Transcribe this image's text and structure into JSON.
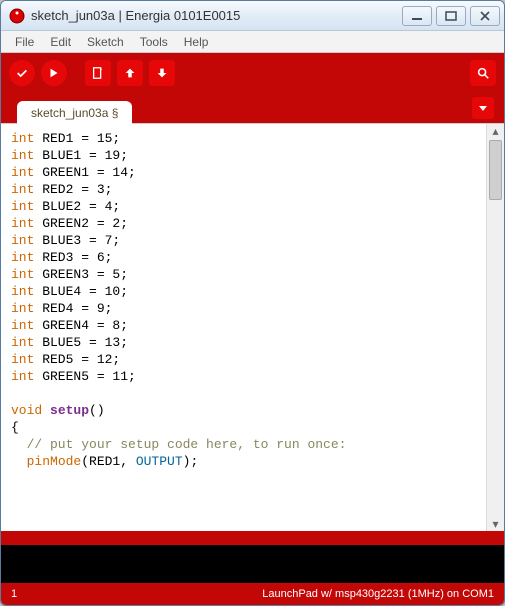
{
  "window": {
    "title": "sketch_jun03a | Energia 0101E0015"
  },
  "menu": {
    "file": "File",
    "edit": "Edit",
    "sketch": "Sketch",
    "tools": "Tools",
    "help": "Help"
  },
  "tabs": {
    "active": "sketch_jun03a §"
  },
  "code": {
    "lines": [
      {
        "t": "decl",
        "kw": "int",
        "name": "RED1",
        "val": "15"
      },
      {
        "t": "decl",
        "kw": "int",
        "name": "BLUE1",
        "val": "19"
      },
      {
        "t": "decl",
        "kw": "int",
        "name": "GREEN1",
        "val": "14"
      },
      {
        "t": "decl",
        "kw": "int",
        "name": "RED2",
        "val": "3"
      },
      {
        "t": "decl",
        "kw": "int",
        "name": "BLUE2",
        "val": "4"
      },
      {
        "t": "decl",
        "kw": "int",
        "name": "GREEN2",
        "val": "2"
      },
      {
        "t": "decl",
        "kw": "int",
        "name": "BLUE3",
        "val": "7"
      },
      {
        "t": "decl",
        "kw": "int",
        "name": "RED3",
        "val": "6"
      },
      {
        "t": "decl",
        "kw": "int",
        "name": "GREEN3",
        "val": "5"
      },
      {
        "t": "decl",
        "kw": "int",
        "name": "BLUE4",
        "val": "10"
      },
      {
        "t": "decl",
        "kw": "int",
        "name": "RED4",
        "val": "9"
      },
      {
        "t": "decl",
        "kw": "int",
        "name": "GREEN4",
        "val": "8"
      },
      {
        "t": "decl",
        "kw": "int",
        "name": "BLUE5",
        "val": "13"
      },
      {
        "t": "decl",
        "kw": "int",
        "name": "RED5",
        "val": "12"
      },
      {
        "t": "decl",
        "kw": "int",
        "name": "GREEN5",
        "val": "11"
      },
      {
        "t": "blank"
      },
      {
        "t": "funcsig",
        "kw": "void",
        "name": "setup",
        "args": "()"
      },
      {
        "t": "brace",
        "ch": "{"
      },
      {
        "t": "comment",
        "text": "  // put your setup code here, to run once:"
      },
      {
        "t": "call",
        "indent": "  ",
        "fn": "pinMode",
        "arg1": "RED1",
        "arg2": "OUTPUT"
      }
    ]
  },
  "status": {
    "line": "1",
    "board": "LaunchPad w/ msp430g2231 (1MHz) on COM1"
  }
}
